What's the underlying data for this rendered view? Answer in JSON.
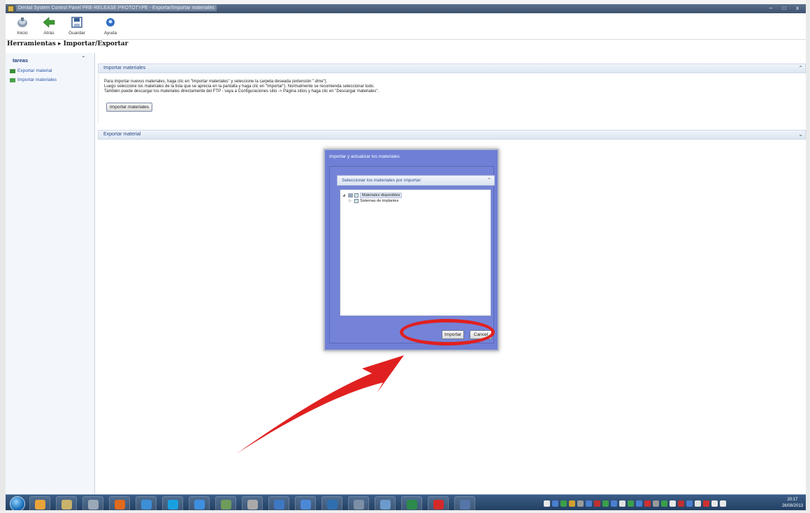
{
  "window": {
    "title": "Dental System Control Panel PRE-RELEASE PROTOTYPE - Exportar/Importar materiales",
    "controls": [
      "–",
      "□",
      "x"
    ]
  },
  "toolbar": {
    "buttons": [
      {
        "label": "Inicio",
        "icon": "home-icon"
      },
      {
        "label": "Atrás",
        "icon": "back-arrow-icon"
      },
      {
        "label": "Guardar",
        "icon": "save-icon"
      },
      {
        "label": "Ayuda",
        "icon": "help-icon"
      }
    ]
  },
  "breadcrumb": "Herramientas ▸ Importar/Exportar",
  "sidebar": {
    "heading": "tareas",
    "collapse_symbol": "⌃",
    "items": [
      {
        "label": "Exportar material",
        "icon": "export-icon"
      },
      {
        "label": "Importar materiales",
        "icon": "import-icon"
      }
    ]
  },
  "import_panel": {
    "title": "Importar materiales",
    "collapse_symbol": "⌃",
    "lines": [
      "Para importar nuevos materiales, haga clic en \"Importar materiales\" y seleccione la carpeta deseada (extensión \".dme\").",
      "Luego seleccione los materiales de la lista que se aprecia en la pantalla y haga clic en \"Importar\"). Normalmente se recomienda seleccionar todo.",
      "También puede descargar los materiales directamente del FTP - vaya a Configuraciones sitio -> Página sitios y haga clic en \"Descargar materiales\"."
    ],
    "button_label": "Importar materiales"
  },
  "export_panel": {
    "title": "Exportar material",
    "expand_symbol": "⌄"
  },
  "dialog": {
    "title": "Importar y actualizar los materiales",
    "section_title": "Seleccionar los materiales por importar:",
    "section_symbol": "⌃",
    "tree": [
      {
        "label": "Materiales disponibles",
        "checked": true,
        "expanded": true,
        "level": 0
      },
      {
        "label": "Sistemas de implantes",
        "checked": true,
        "expanded": false,
        "level": 1
      }
    ],
    "ok_label": "Importar",
    "cancel_label": "Cancel"
  },
  "taskbar": {
    "time": "20:17",
    "date": "26/08/2013",
    "apps": [
      {
        "icon": "chrome-icon",
        "color": "#e8a33b"
      },
      {
        "icon": "sumatra-icon",
        "color": "#c9b26b"
      },
      {
        "icon": "tool-icon",
        "color": "#9aa8b8"
      },
      {
        "icon": "firefox-icon",
        "color": "#e06a1e"
      },
      {
        "icon": "internet-explorer-icon",
        "color": "#3d8fd6"
      },
      {
        "icon": "skype-icon",
        "color": "#19a0e0"
      },
      {
        "icon": "messenger-icon",
        "color": "#3f8fdf"
      },
      {
        "icon": "network-icon",
        "color": "#6e9c5a"
      },
      {
        "icon": "paint-icon",
        "color": "#a9a9a9"
      },
      {
        "icon": "outlook-icon",
        "color": "#3e78c2"
      },
      {
        "icon": "media-player-icon",
        "color": "#4c88d6"
      },
      {
        "icon": "dental-app-icon",
        "color": "#2f6fb0"
      },
      {
        "icon": "explorer-icon",
        "color": "#7d8fa6"
      },
      {
        "icon": "photos-icon",
        "color": "#6c9acb"
      },
      {
        "icon": "excel-icon",
        "color": "#2c8a4a"
      },
      {
        "icon": "acrobat-icon",
        "color": "#d42a2a"
      },
      {
        "icon": "remote-icon",
        "color": "#5575a8"
      }
    ]
  },
  "annotation": {
    "ellipse_color": "#e02020",
    "arrow_color": "#e02020"
  }
}
